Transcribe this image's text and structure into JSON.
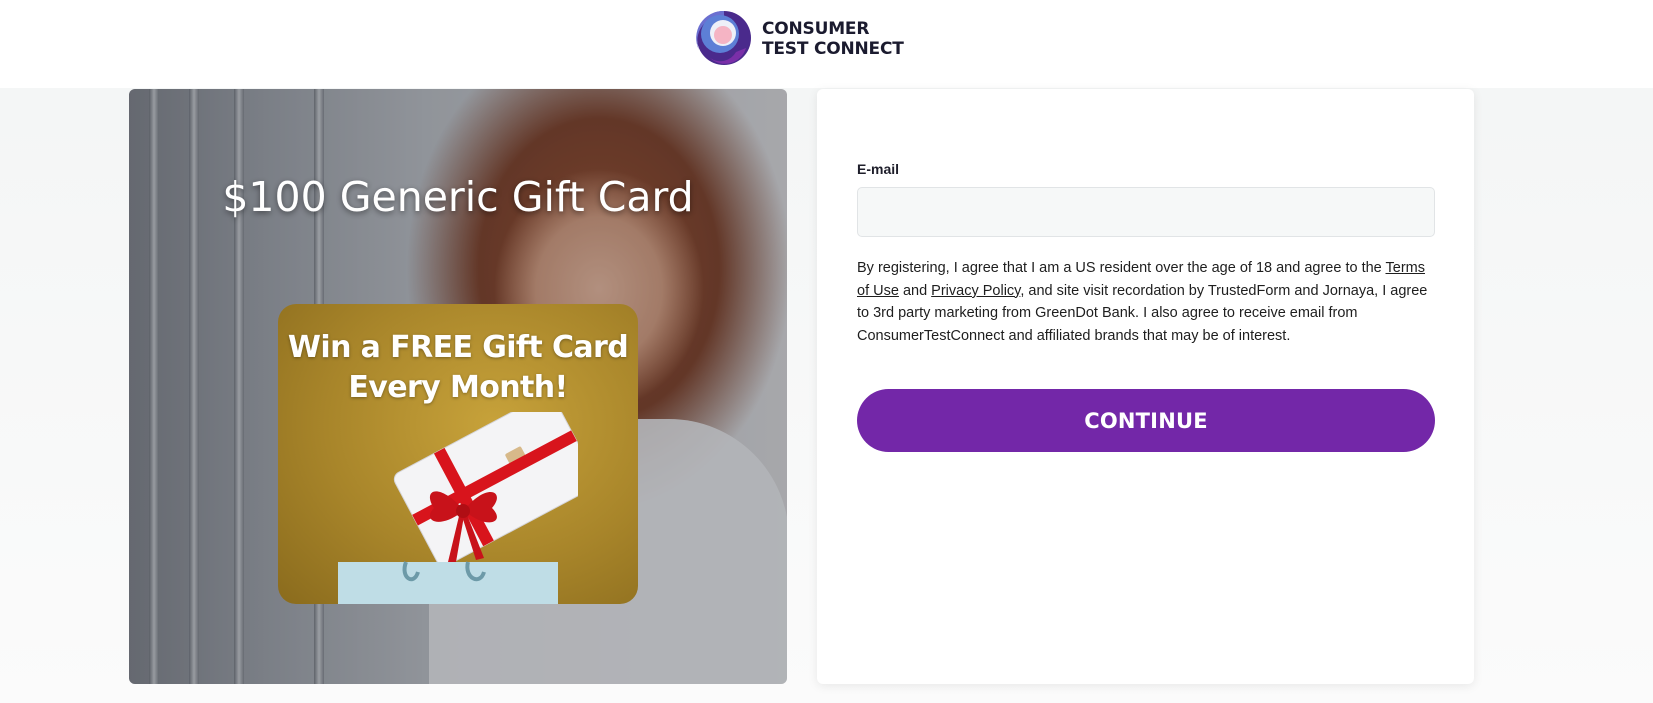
{
  "brand": {
    "line1": "CONSUMER",
    "line2": "TEST CONNECT",
    "logo_icon": "consumer-test-connect-logo-icon",
    "colors": {
      "purple": "#7327a8",
      "blue": "#4f6ec8",
      "pink": "#f4b6c4"
    }
  },
  "hero": {
    "title": "$100 Generic Gift Card",
    "promo_line1": "Win a FREE Gift Card",
    "promo_line2": "Every Month!"
  },
  "form": {
    "email_label": "E-mail",
    "email_value": "",
    "email_placeholder": "",
    "consent_part1": "By registering, I agree that I am a US resident over the age of 18 and agree to the ",
    "terms_link": "Terms of Use",
    "consent_and": " and ",
    "privacy_link": "Privacy Policy",
    "consent_part2": ", and site visit recordation by TrustedForm and Jornaya, I agree to 3rd party marketing from GreenDot Bank. I also agree to receive email from ConsumerTestConnect and affiliated brands that may be of interest.",
    "continue_label": "CONTINUE",
    "button_color": "#7327a8"
  }
}
